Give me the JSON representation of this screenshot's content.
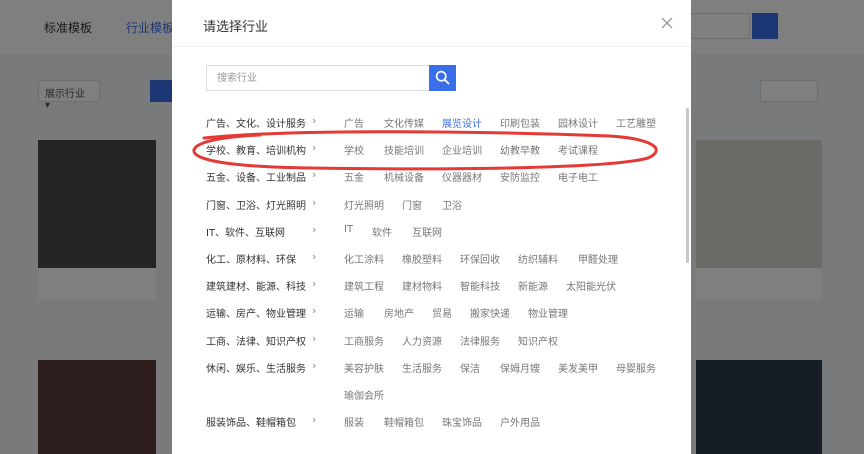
{
  "modal": {
    "title": "请选择行业",
    "search_placeholder": "搜索行业"
  },
  "accent_color": "#3a6ee8",
  "annotation_color": "#e53935",
  "background": {
    "tabs": [
      "标准模板",
      "行业模板"
    ],
    "filter_label": "展示行业 ▾"
  },
  "industries": [
    {
      "name": "广告、文化、设计服务",
      "subs": [
        "广告",
        "文化传媒",
        "展览设计",
        "印刷包装",
        "园林设计",
        "工艺雕塑"
      ],
      "active_sub": 2
    },
    {
      "name": "学校、教育、培训机构",
      "subs": [
        "学校",
        "技能培训",
        "企业培训",
        "幼教早教",
        "考试课程"
      ]
    },
    {
      "name": "五金、设备、工业制品",
      "subs": [
        "五金",
        "机械设备",
        "仪器器材",
        "安防监控",
        "电子电工"
      ]
    },
    {
      "name": "门窗、卫浴、灯光照明",
      "subs": [
        "灯光照明",
        "门窗",
        "卫浴"
      ]
    },
    {
      "name": "IT、软件、互联网",
      "subs": [
        "IT",
        "软件",
        "互联网"
      ]
    },
    {
      "name": "化工、原材料、环保",
      "subs": [
        "化工涂料",
        "橡胶塑料",
        "环保回收",
        "纺织辅料",
        "甲醛处理"
      ]
    },
    {
      "name": "建筑建材、能源、科技",
      "subs": [
        "建筑工程",
        "建材物料",
        "智能科技",
        "新能源",
        "太阳能光伏"
      ]
    },
    {
      "name": "运输、房产、物业管理",
      "subs": [
        "运输",
        "房地产",
        "贸易",
        "搬家快递",
        "物业管理"
      ]
    },
    {
      "name": "工商、法律、知识产权",
      "subs": [
        "工商服务",
        "人力资源",
        "法律服务",
        "知识产权"
      ]
    },
    {
      "name": "休闲、娱乐、生活服务",
      "subs": [
        "美容护肤",
        "生活服务",
        "保洁",
        "保姆月嫂",
        "美发美甲",
        "母婴服务",
        "瑜伽会所"
      ]
    },
    {
      "name": "服装饰品、鞋帽箱包",
      "subs": [
        "服装",
        "鞋帽箱包",
        "珠宝饰品",
        "户外用品"
      ]
    }
  ]
}
